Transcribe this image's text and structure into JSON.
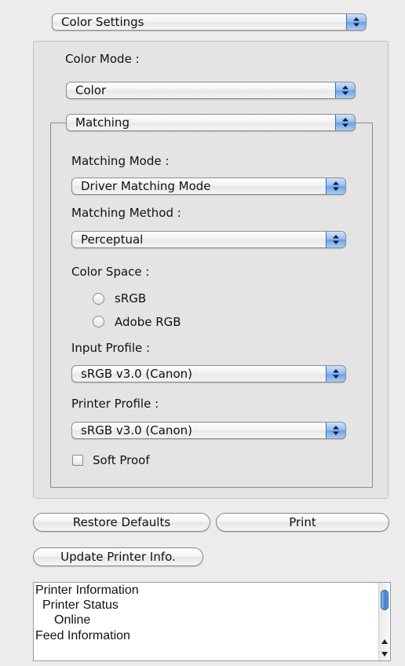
{
  "color_settings_popup": {
    "value": "Color Settings"
  },
  "color_mode": {
    "label": "Color Mode :",
    "value": "Color"
  },
  "matching_popup": {
    "value": "Matching"
  },
  "matching_mode": {
    "label": "Matching Mode :",
    "value": "Driver Matching Mode"
  },
  "matching_method": {
    "label": "Matching Method :",
    "value": "Perceptual"
  },
  "color_space": {
    "label": "Color Space :",
    "options": [
      "sRGB",
      "Adobe RGB"
    ]
  },
  "input_profile": {
    "label": "Input Profile :",
    "value": "sRGB v3.0 (Canon)"
  },
  "printer_profile": {
    "label": "Printer Profile :",
    "value": "sRGB v3.0 (Canon)"
  },
  "soft_proof": {
    "label": "Soft Proof",
    "checked": false
  },
  "buttons": {
    "restore_defaults": "Restore Defaults",
    "print": "Print",
    "update_printer_info": "Update Printer Info."
  },
  "info_list": {
    "lines": [
      "Printer Information",
      "Printer Status",
      "Online",
      "Feed Information"
    ]
  },
  "icons": {
    "popup_arrows": "up-down-arrows-icon",
    "scroll_up": "scroll-up-arrow-icon",
    "scroll_down": "scroll-down-arrow-icon"
  },
  "colors": {
    "accent": "#6aa0e6",
    "background": "#ececec",
    "group_background": "#e4e4e4"
  }
}
